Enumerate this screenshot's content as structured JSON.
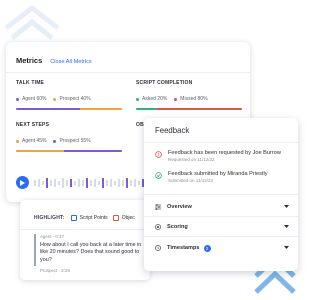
{
  "metrics": {
    "title": "Metrics",
    "close_link": "Close All Metrics",
    "talk_time": {
      "label": "TALK TIME",
      "agent": "Agent 60%",
      "prospect": "Prospect 40%",
      "agent_share": 0.6,
      "prospect_share": 0.4
    },
    "script_completion": {
      "label": "SCRIPT COMPLETION",
      "asked": "Asked 20%",
      "missed": "Missed 80%",
      "asked_share": 0.2,
      "missed_share": 0.8
    },
    "next_steps": {
      "label": "NEXT STEPS",
      "agent": "Agent 45%",
      "prospect": "Prospect 55%",
      "agent_share": 0.45,
      "prospect_share": 0.55
    },
    "objections": {
      "label": "OBJ"
    }
  },
  "transcript": {
    "highlight_label": "HIGHLIGHT:",
    "options": [
      "Script Points",
      "Objec"
    ],
    "speaker_agent": "Agent - 0:37",
    "utterance": "How about I call you back at a later time in like 20 minutes? Does that sound good to you?",
    "speaker_prospect": "Prospect - 2:29"
  },
  "feedback": {
    "title": "Feedback",
    "items": [
      {
        "text": "Feedback has been requested by Joe Burrow",
        "date": "Requested on 11/12/22",
        "status": "requested"
      },
      {
        "text": "Feedback submitted by Miranda Priestly",
        "date": "Submitted on 11/12/22",
        "status": "submitted"
      }
    ],
    "sections": [
      {
        "label": "Overview",
        "icon": "sliders-icon"
      },
      {
        "label": "Scoring",
        "icon": "target-icon"
      },
      {
        "label": "Timestamps",
        "icon": "clock-icon",
        "badge": "2"
      }
    ]
  },
  "colors": {
    "accent": "#2b6cf5",
    "agent": "#7b5cd6",
    "prospect": "#f2a33a",
    "asked": "#33b37a",
    "missed": "#e0553f"
  }
}
